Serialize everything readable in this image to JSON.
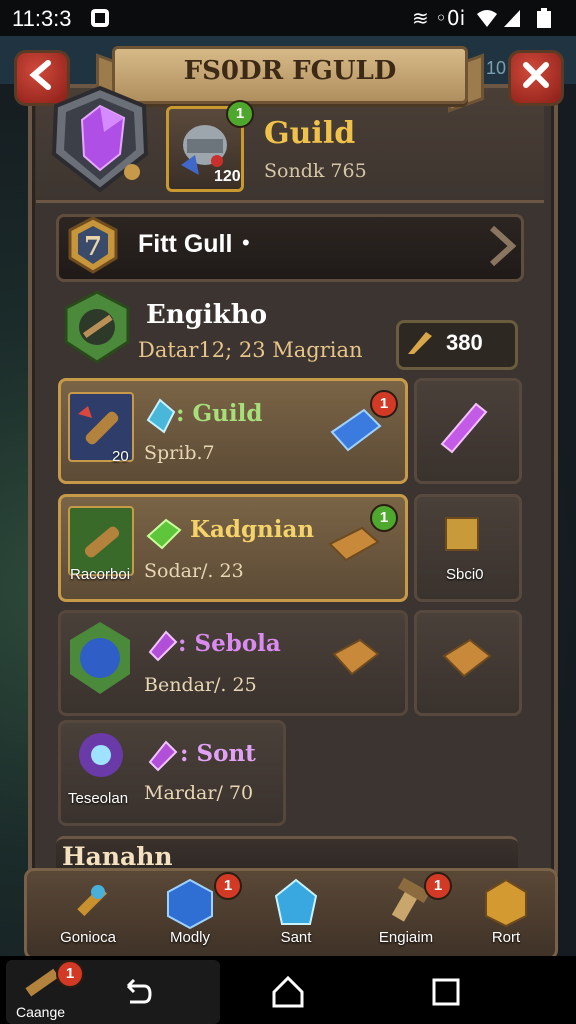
{
  "status_bar": {
    "time": "11:3:3",
    "right_text": "≋ ◦0i"
  },
  "background": {
    "top_right_text": "4 10"
  },
  "header": {
    "title": "FS0DR FGULD",
    "guild_name": "Guild",
    "guild_sub": "Sondk 765",
    "item_level": "120",
    "item_badge": "1"
  },
  "rank": {
    "number": "7",
    "label": "Fitt Gull",
    "dot": "•"
  },
  "member": {
    "name": "Engikho",
    "sub": "Datar12; 23 Magrian",
    "coins": "380"
  },
  "rows": [
    {
      "thumb_label": "20",
      "name": ": Guild",
      "sub": "Sprib.7",
      "name_color": "#a7e07a",
      "badge": "1",
      "badge_color": "red",
      "side_label": ""
    },
    {
      "thumb_label": "Racorboi",
      "name": "Kadgnian",
      "sub": "Sodar/. 23",
      "name_color": "#f3d36a",
      "badge": "1",
      "badge_color": "green",
      "side_label": "Sbci0"
    },
    {
      "thumb_label": "",
      "name": ": Sebola",
      "sub": "Bendar/. 25",
      "name_color": "#d98bf0",
      "badge": "",
      "badge_color": "",
      "side_label": ""
    },
    {
      "thumb_label": "Teseolan",
      "name": ": Sont",
      "sub": "Mardar/ 70",
      "name_color": "#e1a2f5",
      "badge": "",
      "badge_color": "",
      "side_label": ""
    }
  ],
  "section_title": "Hanahn",
  "tabs": [
    {
      "label": "Gonioca",
      "badge": ""
    },
    {
      "label": "Modly",
      "badge": "1"
    },
    {
      "label": "Sant",
      "badge": ""
    },
    {
      "label": "Engiaim",
      "badge": "1"
    },
    {
      "label": "Rort",
      "badge": ""
    }
  ],
  "nav": {
    "app_label": "Caange",
    "app_badge": "1"
  },
  "colors": {
    "accent_gold": "#f0c24a",
    "badge_red": "#d23a26",
    "badge_green": "#4ea82d"
  }
}
